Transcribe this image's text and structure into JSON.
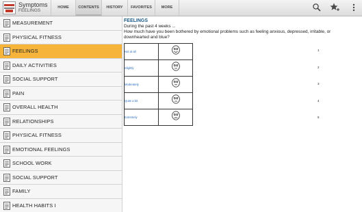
{
  "app": {
    "title": "Symptoms",
    "subtitle": "FEELINGS"
  },
  "tabs": [
    {
      "label": "HOME",
      "active": false
    },
    {
      "label": "CONTENTS",
      "active": true
    },
    {
      "label": "HISTORY",
      "active": false
    },
    {
      "label": "FAVORITES",
      "active": false
    },
    {
      "label": "MORE",
      "active": false
    }
  ],
  "toolbar_icons": [
    "search-icon",
    "star-plus-icon",
    "overflow-menu-icon"
  ],
  "sidebar": {
    "items": [
      {
        "label": "MEASUREMENT",
        "active": false
      },
      {
        "label": "PHYSICAL FITNESS",
        "active": false
      },
      {
        "label": "FEELINGS",
        "active": true
      },
      {
        "label": "DAILY ACTIVITIES",
        "active": false
      },
      {
        "label": "SOCIAL SUPPORT",
        "active": false
      },
      {
        "label": "PAIN",
        "active": false
      },
      {
        "label": "OVERALL HEALTH",
        "active": false
      },
      {
        "label": "RELATIONSHIPS",
        "active": false
      },
      {
        "label": "PHYSICAL FITNESS",
        "active": false
      },
      {
        "label": "EMOTIONAL FEELINGS",
        "active": false
      },
      {
        "label": "SCHOOL WORK",
        "active": false
      },
      {
        "label": "SOCIAL SUPPORT",
        "active": false
      },
      {
        "label": "FAMILY",
        "active": false
      },
      {
        "label": "HEALTH HABITS I",
        "active": false
      }
    ]
  },
  "content": {
    "title": "FEELINGS",
    "intro_line1": "During the past 4 weeks ...",
    "intro_line2": "How much have you been bothered by emotional problems such as feeling anxious, depressed, irritable, or downhearted and blue?",
    "answers": [
      {
        "label": "Not at all",
        "score": "1",
        "face": "happy"
      },
      {
        "label": "Slightly",
        "score": "2",
        "face": "slight-smile"
      },
      {
        "label": "Moderately",
        "score": "3",
        "face": "neutral"
      },
      {
        "label": "Quite a bit",
        "score": "4",
        "face": "slight-frown"
      },
      {
        "label": "Extremely",
        "score": "5",
        "face": "sad"
      }
    ]
  },
  "colors": {
    "active_item": "#f6b53a",
    "content_title": "#1f5d8a",
    "option_text": "#2a6dba"
  }
}
